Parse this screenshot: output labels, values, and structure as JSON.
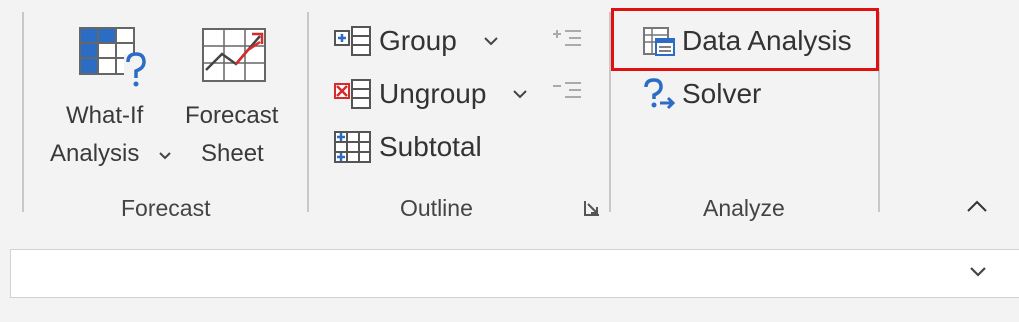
{
  "forecast_group": {
    "label": "Forecast",
    "what_if": {
      "line1": "What-If",
      "line2": "Analysis"
    },
    "forecast_sheet": {
      "line1": "Forecast",
      "line2": "Sheet"
    }
  },
  "outline_group": {
    "label": "Outline",
    "group": "Group",
    "ungroup": "Ungroup",
    "subtotal": "Subtotal"
  },
  "analyze_group": {
    "label": "Analyze",
    "data_analysis": "Data Analysis",
    "solver": "Solver"
  },
  "colors": {
    "highlight": "#e01010",
    "icon_blue": "#2b6cc4",
    "icon_red": "#d62b2b"
  }
}
